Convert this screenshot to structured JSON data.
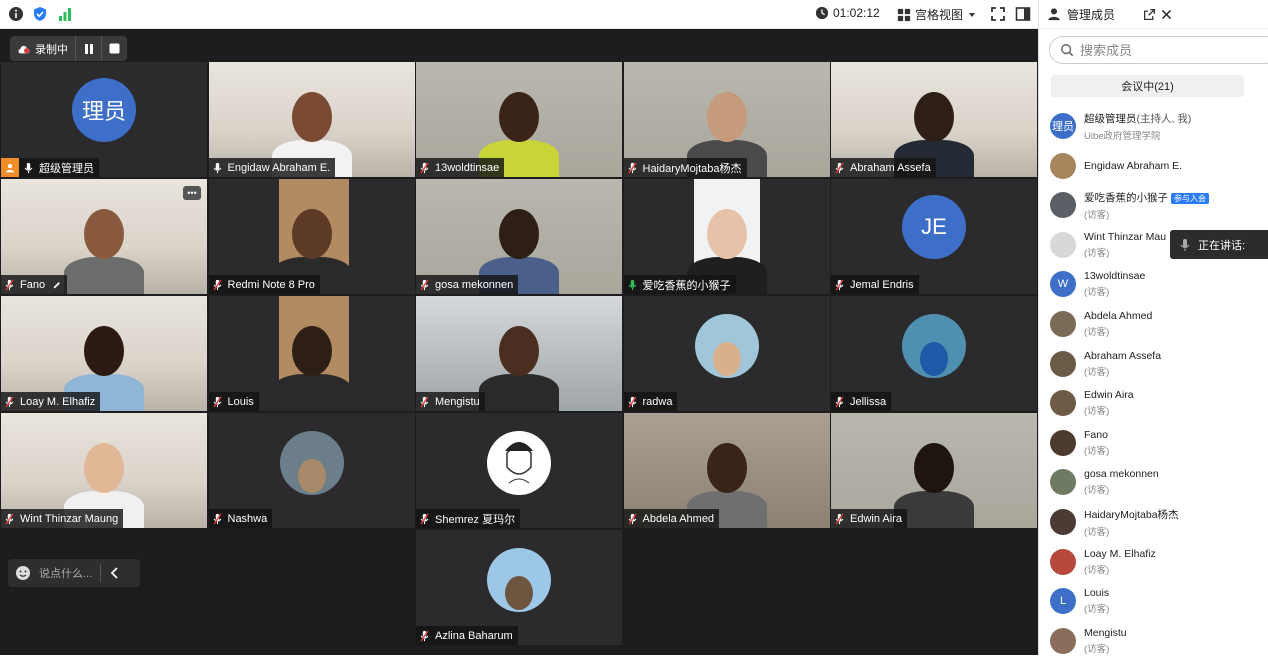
{
  "topbar": {
    "timer": "01:02:12",
    "view_label": "宫格视图"
  },
  "recording": {
    "label": "录制中"
  },
  "tiles": [
    {
      "name": "超级管理员",
      "avatar_text": "理员",
      "type": "avatar",
      "col": 0,
      "row": 0,
      "host": true
    },
    {
      "name": "Engidaw Abraham E.",
      "type": "video",
      "col": 1,
      "row": 0,
      "scene": "room",
      "skin": "#7a4a33",
      "shirt": "#f2f2f2"
    },
    {
      "name": "13woldtinsae",
      "type": "video",
      "col": 2,
      "row": 0,
      "scene": "wall",
      "skin": "#3a2418",
      "shirt": "#c8d438"
    },
    {
      "name": "HaidaryMojtaba杨杰",
      "type": "video",
      "col": 3,
      "row": 0,
      "scene": "wall",
      "skin": "#c69b7b",
      "shirt": "#4a4a4a"
    },
    {
      "name": "Abraham Assefa",
      "type": "video",
      "col": 4,
      "row": 0,
      "scene": "room",
      "skin": "#2e1f16",
      "shirt": "#242a33"
    },
    {
      "name": "Fano",
      "type": "video",
      "col": 0,
      "row": 1,
      "scene": "room",
      "skin": "#8a5a3e",
      "shirt": "#6c6c6c"
    },
    {
      "name": "Redmi Note 8 Pro",
      "type": "video",
      "col": 1,
      "row": 1,
      "scene": "wood",
      "skin": "#5c3a26",
      "shirt": "#2a2a2a"
    },
    {
      "name": "gosa mekonnen",
      "type": "video",
      "col": 2,
      "row": 1,
      "scene": "wall",
      "skin": "#2e1f16",
      "shirt": "#4a5f8a"
    },
    {
      "name": "爱吃香蕉的小猴子",
      "type": "video",
      "col": 3,
      "row": 1,
      "scene": "light",
      "skin": "#e6c3a8",
      "shirt": "#1f1f1f",
      "active": true
    },
    {
      "name": "Jemal Endris",
      "avatar_text": "JE",
      "type": "avatar",
      "col": 4,
      "row": 1
    },
    {
      "name": "Loay M. Elhafiz",
      "type": "video",
      "col": 0,
      "row": 2,
      "scene": "room",
      "skin": "#2a1a12",
      "shirt": "#8fb6d6"
    },
    {
      "name": "Louis",
      "type": "video",
      "col": 1,
      "row": 2,
      "scene": "wood",
      "skin": "#2e1f16",
      "shirt": "#2a2a2a"
    },
    {
      "name": "Mengistu",
      "type": "video",
      "col": 2,
      "row": 2,
      "scene": "office",
      "skin": "#4a2f20",
      "shirt": "#2a2a2a"
    },
    {
      "name": "radwa",
      "type": "photo",
      "col": 3,
      "row": 2,
      "circle": "#9fc7d9",
      "skin": "#d9b08c"
    },
    {
      "name": "Jellissa",
      "type": "photo",
      "col": 4,
      "row": 2,
      "circle": "#4f8fb0",
      "skin": "#1f5aa8"
    },
    {
      "name": "Wint Thinzar Maung",
      "type": "video",
      "col": 0,
      "row": 3,
      "scene": "room",
      "skin": "#e0b896",
      "shirt": "#f0f0f0"
    },
    {
      "name": "Nashwa",
      "type": "photo",
      "col": 1,
      "row": 3,
      "circle": "#6b7e8a",
      "skin": "#a88a6a"
    },
    {
      "name": "Shemrez 夏玛尔",
      "type": "photo",
      "col": 2,
      "row": 3,
      "circle": "#ffffff",
      "skin": "#f3f3f3",
      "sketch": true
    },
    {
      "name": "Abdela Ahmed",
      "type": "video",
      "col": 3,
      "row": 3,
      "scene": "wall2",
      "skin": "#3a2418",
      "shirt": "#6f6f6f"
    },
    {
      "name": "Edwin Aira",
      "type": "video",
      "col": 4,
      "row": 3,
      "scene": "wall",
      "skin": "#1e1410",
      "shirt": "#3a3a3a"
    },
    {
      "name": "Azlina Baharum",
      "type": "photo",
      "col": 2,
      "row": 4,
      "circle": "#9cc7e6",
      "skin": "#6e5540"
    }
  ],
  "chat": {
    "placeholder": "说点什么..."
  },
  "panel": {
    "title": "管理成员",
    "search_placeholder": "搜索成员",
    "tab_label": "会议中(21)",
    "speaking_label": "正在讲话:",
    "members": [
      {
        "name": "超级管理员",
        "extra": "(主持人, 我)",
        "sub": "Uibe政府管理学院",
        "avatar_text": "理员",
        "avatar_color": "#3d6fc8"
      },
      {
        "name": "Engidaw Abraham E.",
        "sub": "",
        "avatar_color": "#a7865e"
      },
      {
        "name": "爱吃香蕉的小猴子",
        "tag": "参与入会",
        "sub": "(访客)",
        "avatar_color": "#5a5f66"
      },
      {
        "name": "Wint Thinzar Mau",
        "sub": "(访客)",
        "avatar_color": "#d8d8d8"
      },
      {
        "name": "13woldtinsae",
        "sub": "(访客)",
        "avatar_text": "W",
        "avatar_color": "#3d6fc8"
      },
      {
        "name": "Abdela Ahmed",
        "sub": "(访客)",
        "avatar_color": "#7b6a55"
      },
      {
        "name": "Abraham Assefa",
        "sub": "(访客)",
        "avatar_color": "#6b5a45"
      },
      {
        "name": "Edwin Aira",
        "sub": "(访客)",
        "avatar_color": "#6e5b46"
      },
      {
        "name": "Fano",
        "sub": "(访客)",
        "avatar_color": "#4e3b30"
      },
      {
        "name": "gosa mekonnen",
        "sub": "(访客)",
        "avatar_color": "#6f7a62"
      },
      {
        "name": "HaidaryMojtaba杨杰",
        "sub": "(访客)",
        "avatar_color": "#4b3b34"
      },
      {
        "name": "Loay M. Elhafiz",
        "sub": "(访客)",
        "avatar_color": "#b6473d"
      },
      {
        "name": "Louis",
        "sub": "(访客)",
        "avatar_text": "L",
        "avatar_color": "#3d6fc8"
      },
      {
        "name": "Mengistu",
        "sub": "(访客)",
        "avatar_color": "#8a6d5a"
      }
    ]
  }
}
